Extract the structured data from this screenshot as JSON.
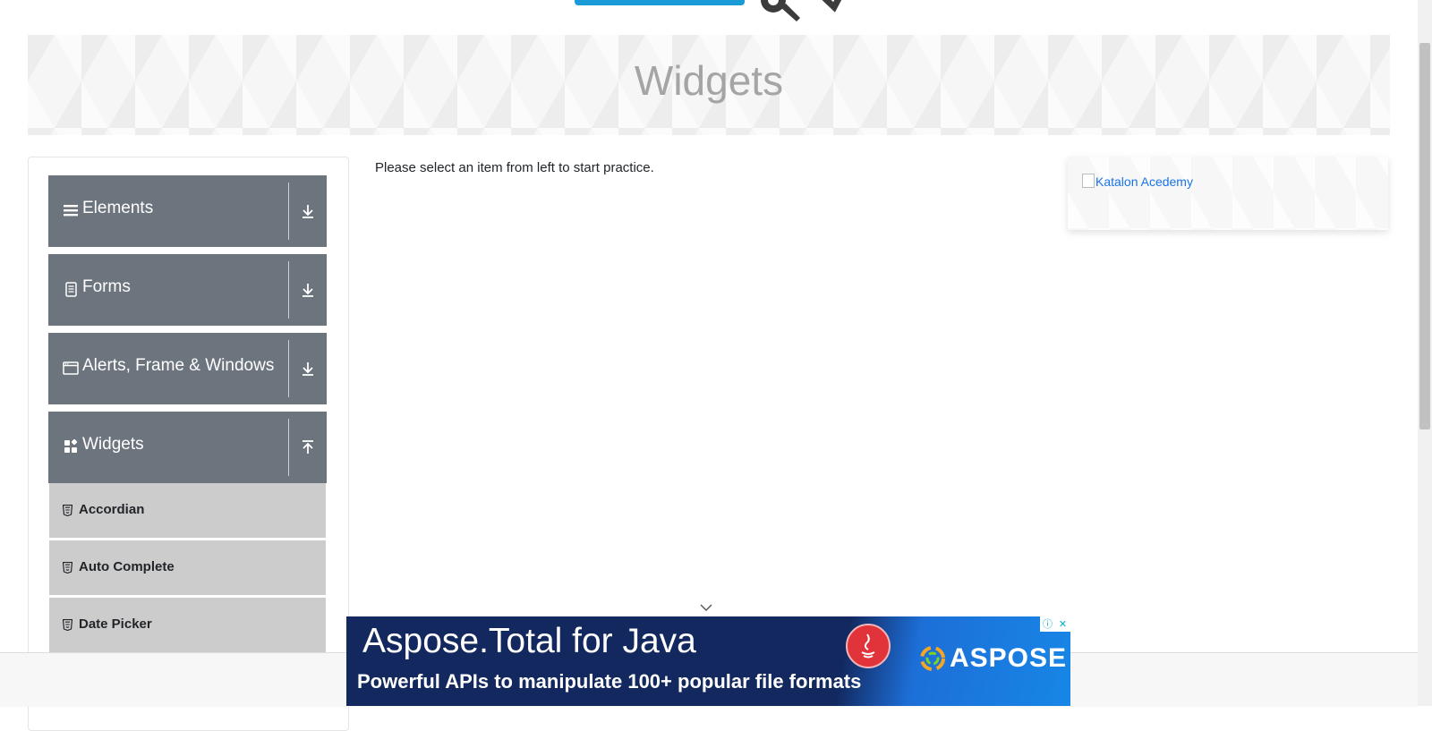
{
  "page": {
    "banner_title": "Widgets",
    "main_instruction": "Please select an item from left to start practice."
  },
  "sidebar": {
    "groups": [
      {
        "label": "Elements",
        "icon": "hamburger-icon",
        "expanded": false
      },
      {
        "label": "Forms",
        "icon": "document-icon",
        "expanded": false
      },
      {
        "label": "Alerts, Frame & Windows",
        "icon": "window-icon",
        "expanded": false
      },
      {
        "label": "Widgets",
        "icon": "widgets-icon",
        "expanded": true
      }
    ],
    "widget_items": [
      {
        "label": "Accordian",
        "icon": "html5-icon"
      },
      {
        "label": "Auto Complete",
        "icon": "html5-icon"
      },
      {
        "label": "Date Picker",
        "icon": "html5-icon"
      }
    ]
  },
  "side_ad": {
    "alt_text": "Katalon Acedemy"
  },
  "ad_banner": {
    "title": "Aspose.Total for Java",
    "subtitle": "Powerful APIs to manipulate 100+ popular file formats",
    "brand": "ASPOSE",
    "close_label": "✕",
    "info_label": "ⓘ"
  },
  "colors": {
    "sidebar_header": "#6c757d",
    "menu_item": "#cccccc",
    "banner_title": "#a5a5a5",
    "link": "#1a73e8",
    "ad_background": "#12285e"
  }
}
